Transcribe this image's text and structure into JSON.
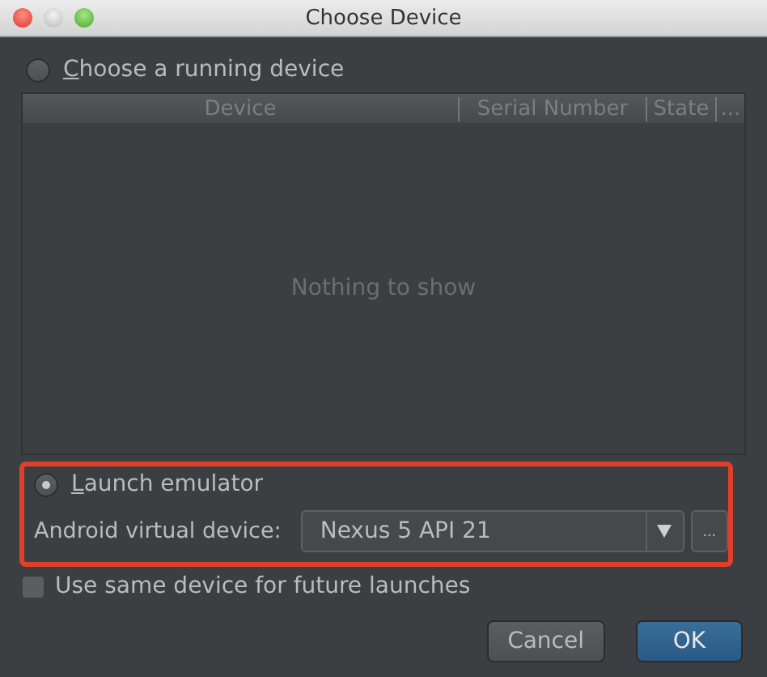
{
  "window": {
    "title": "Choose Device"
  },
  "running_option": {
    "label": "Choose a running device",
    "selected": false
  },
  "table": {
    "columns": [
      "Device",
      "Serial Number",
      "State",
      "..."
    ],
    "empty_text": "Nothing to show"
  },
  "emulator_option": {
    "label": "Launch emulator",
    "selected": true
  },
  "avd": {
    "label": "Android virtual device:",
    "value": "Nexus 5 API 21",
    "more": "..."
  },
  "same_device": {
    "label": "Use same device for future launches",
    "checked": false
  },
  "buttons": [
    {
      "label": "Cancel",
      "default": false
    },
    {
      "label": "OK",
      "default": true
    }
  ]
}
